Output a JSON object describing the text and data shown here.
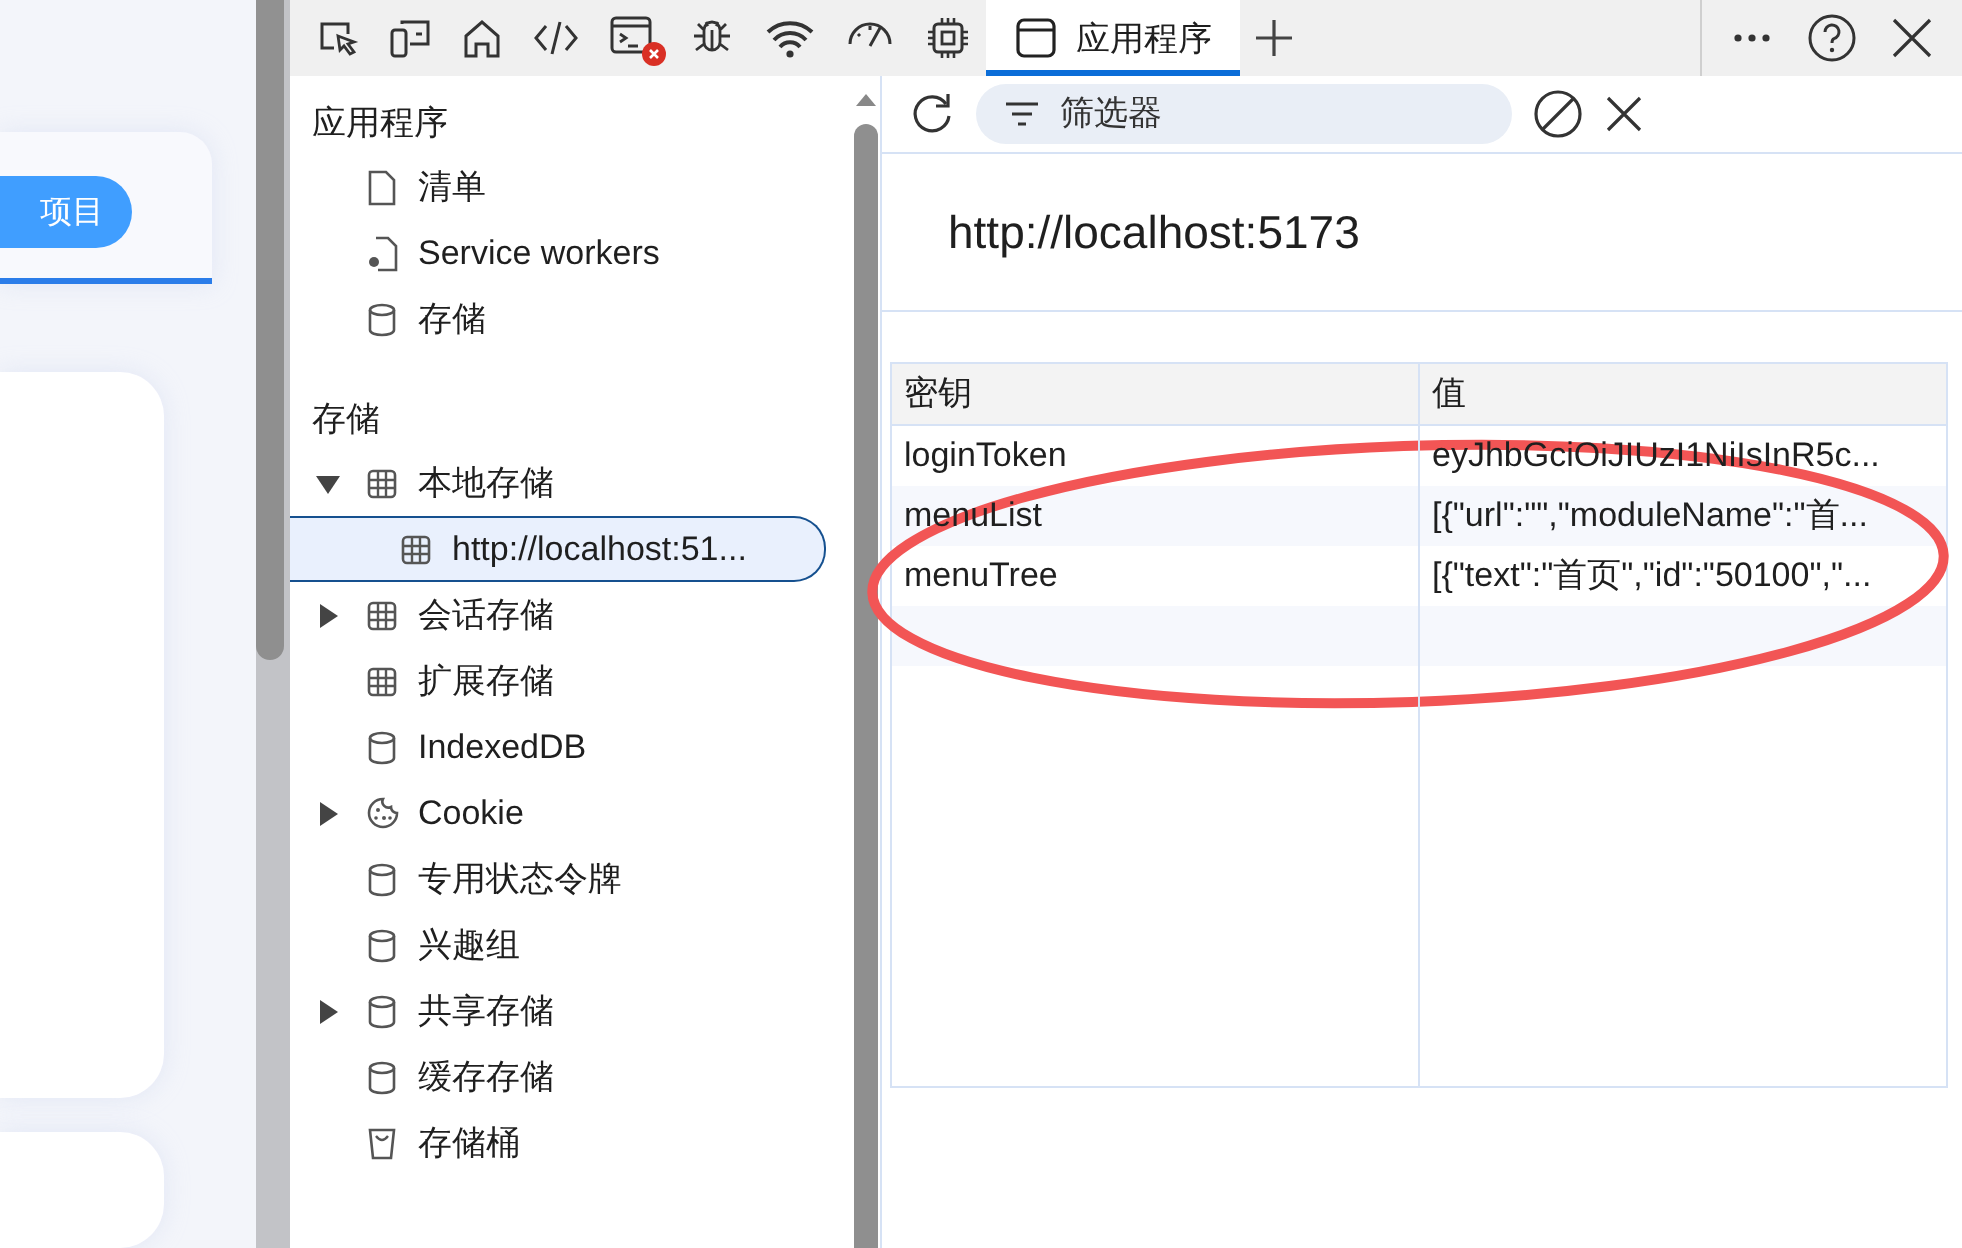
{
  "page": {
    "button": "项目"
  },
  "toolbar": {
    "tabs": [
      {
        "kind": "inspect",
        "selected": false,
        "error": false
      },
      {
        "kind": "device",
        "selected": false,
        "error": false
      },
      {
        "kind": "home",
        "selected": false,
        "error": false
      },
      {
        "kind": "code",
        "selected": false,
        "error": false
      },
      {
        "kind": "console",
        "selected": false,
        "error": true
      },
      {
        "kind": "bug",
        "selected": false,
        "error": false
      },
      {
        "kind": "wifi",
        "selected": false,
        "error": false
      },
      {
        "kind": "gauge",
        "selected": false,
        "error": false
      },
      {
        "kind": "chip",
        "selected": false,
        "error": false
      },
      {
        "kind": "app",
        "label": "应用程序",
        "selected": true,
        "error": false
      }
    ]
  },
  "sidebar": {
    "sections": [
      {
        "title": "应用程序",
        "items": [
          {
            "kind": "file",
            "label": "清单",
            "selected": false
          },
          {
            "kind": "worker",
            "label": "Service workers",
            "selected": false
          },
          {
            "kind": "db",
            "label": "存储",
            "selected": false
          }
        ]
      },
      {
        "title": "存储",
        "items": [
          {
            "kind": "grid",
            "label": "本地存储",
            "expanded": true,
            "selected": false,
            "children": [
              {
                "kind": "grid",
                "label": "http://localhost:51...",
                "selected": true
              }
            ]
          },
          {
            "kind": "grid",
            "label": "会话存储",
            "expanded": false,
            "selected": false
          },
          {
            "kind": "grid",
            "label": "扩展存储",
            "selected": false
          },
          {
            "kind": "db",
            "label": "IndexedDB",
            "selected": false
          },
          {
            "kind": "cookie",
            "label": "Cookie",
            "expanded": false,
            "selected": false
          },
          {
            "kind": "db",
            "label": "专用状态令牌",
            "selected": false
          },
          {
            "kind": "db",
            "label": "兴趣组",
            "selected": false
          },
          {
            "kind": "db",
            "label": "共享存储",
            "expanded": false,
            "selected": false
          },
          {
            "kind": "db",
            "label": "缓存存储",
            "selected": false
          },
          {
            "kind": "bucket",
            "label": "存储桶",
            "selected": false
          }
        ]
      }
    ]
  },
  "filter": {
    "placeholder": "筛选器"
  },
  "origin": "http://localhost:5173",
  "table": {
    "columns": [
      "密钥",
      "值"
    ],
    "rows": [
      [
        "loginToken",
        "eyJhbGciOiJIUzI1NiIsInR5c..."
      ],
      [
        "menuList",
        "[{\"url\":\"\",\"moduleName\":\"首..."
      ],
      [
        "menuTree",
        "[{\"text\":\"首页\",\"id\":\"50100\",\"..."
      ]
    ]
  }
}
